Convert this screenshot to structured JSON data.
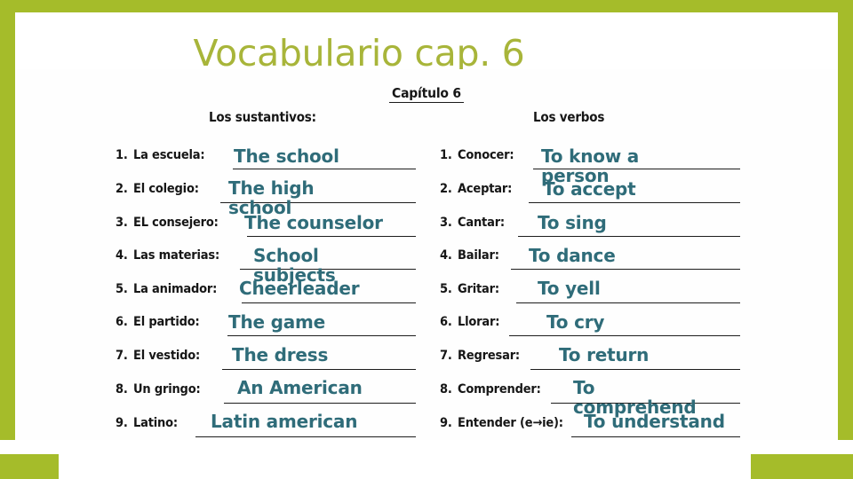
{
  "slide": {
    "title": "Vocabulario cap. 6",
    "accent_green": "#a5bc2a",
    "title_green": "#a8b53a",
    "answer_teal": "#2f6c79",
    "page_background": "#ffffff"
  },
  "worksheet": {
    "heading": "Capítulo 6",
    "nouns_heading": "Los sustantivos:",
    "verbs_heading": "Los verbos",
    "nouns": [
      {
        "num": "1.",
        "term": "La escuela:",
        "answer": "The school"
      },
      {
        "num": "2.",
        "term": "El colegio:",
        "answer": "The high school"
      },
      {
        "num": "3.",
        "term": "EL consejero:",
        "answer": "The counselor"
      },
      {
        "num": "4.",
        "term": "Las materias:",
        "answer": "School subjects"
      },
      {
        "num": "5.",
        "term": "La animador:",
        "answer": "Cheerleader"
      },
      {
        "num": "6.",
        "term": "El partido:",
        "answer": "The game"
      },
      {
        "num": "7.",
        "term": "El vestido:",
        "answer": "The dress"
      },
      {
        "num": "8.",
        "term": "Un gringo:",
        "answer": "An American"
      },
      {
        "num": "9.",
        "term": "Latino:",
        "answer": "Latin american"
      }
    ],
    "verbs": [
      {
        "num": "1.",
        "term": "Conocer:",
        "answer": "To know a person"
      },
      {
        "num": "2.",
        "term": "Aceptar:",
        "answer": "To accept"
      },
      {
        "num": "3.",
        "term": "Cantar:",
        "answer": "To sing"
      },
      {
        "num": "4.",
        "term": "Bailar:",
        "answer": "To dance"
      },
      {
        "num": "5.",
        "term": "Gritar:",
        "answer": "To yell"
      },
      {
        "num": "6.",
        "term": "Llorar:",
        "answer": "To cry"
      },
      {
        "num": "7.",
        "term": "Regresar:",
        "answer": "To return"
      },
      {
        "num": "8.",
        "term": "Comprender:",
        "answer": "To comprehend"
      },
      {
        "num": "9.",
        "term": "Entender (e→ie):",
        "answer": "To understand"
      }
    ]
  }
}
